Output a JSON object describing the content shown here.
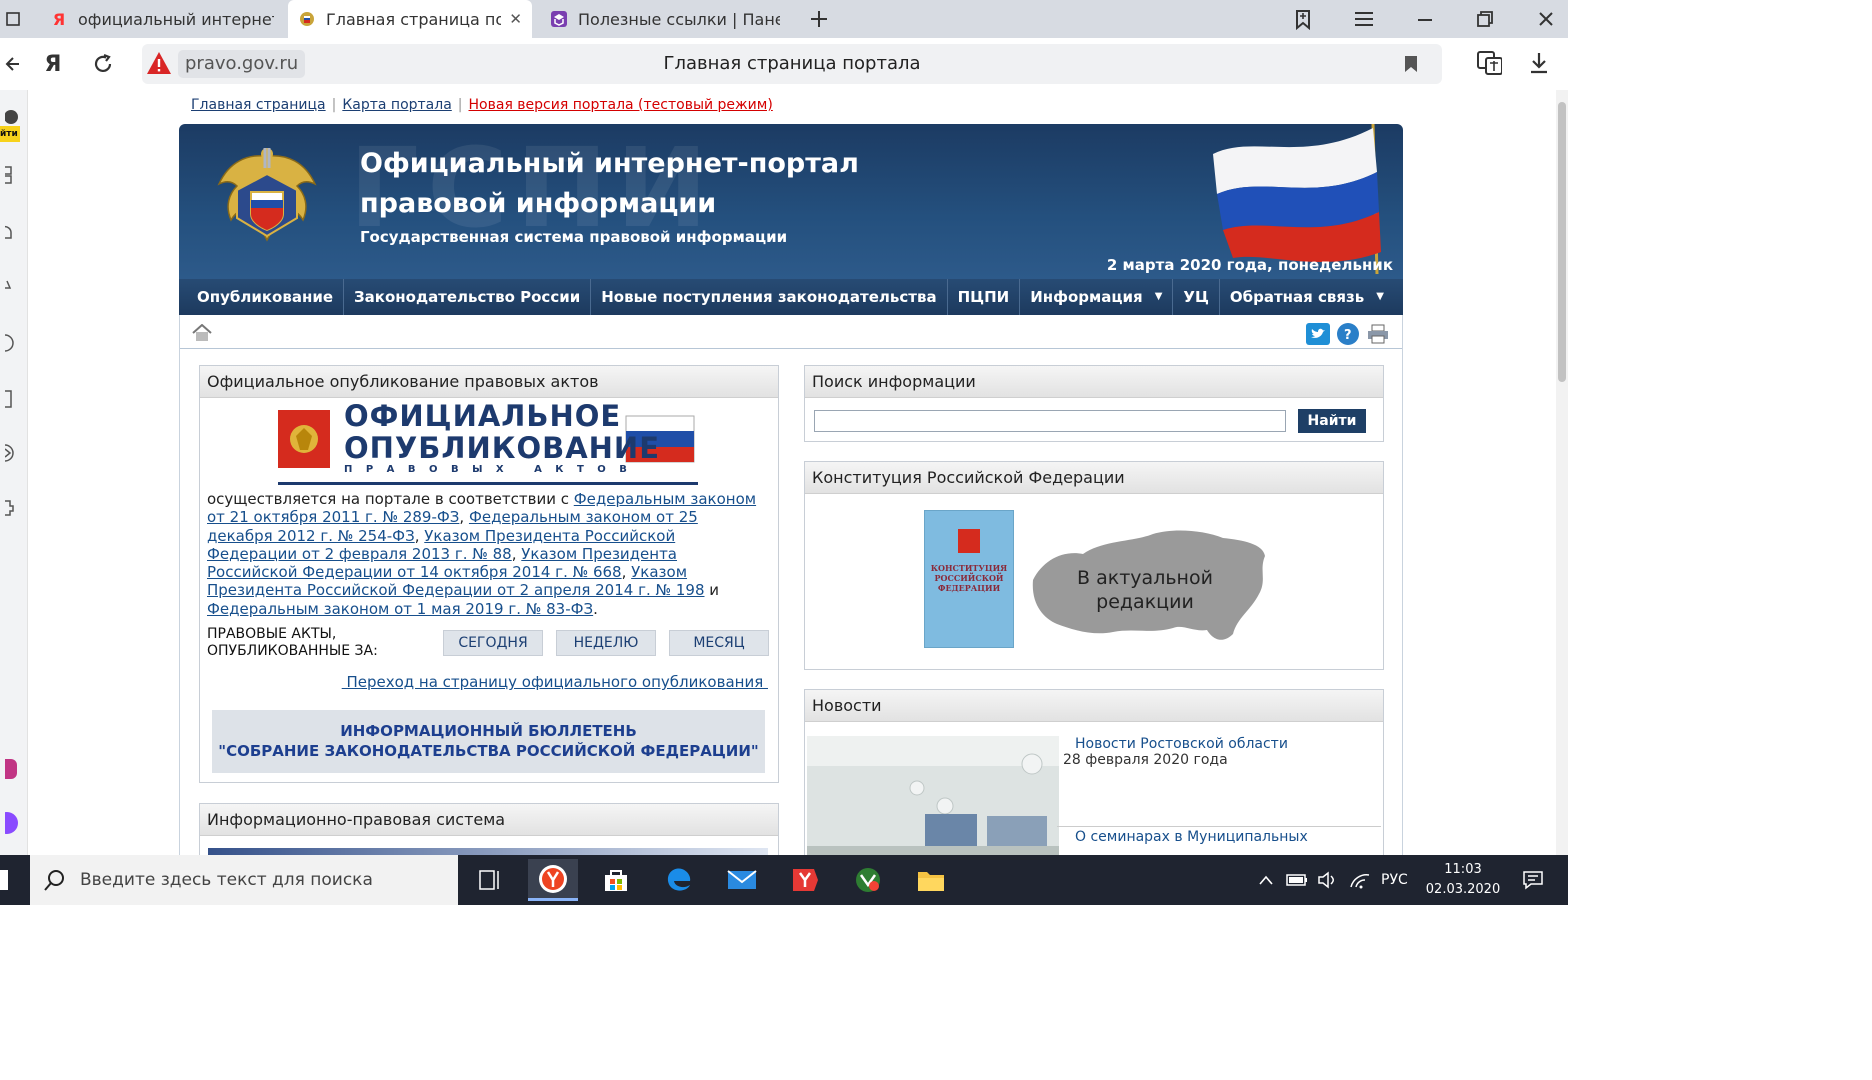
{
  "browser": {
    "tabs": [
      {
        "title": "официальный интернет -п",
        "favicon": "yandex-icon",
        "active": false
      },
      {
        "title": "Главная страница порта",
        "favicon": "emblem-icon",
        "active": true
      },
      {
        "title": "Полезные ссылки | Панель",
        "favicon": "panel-icon",
        "active": false
      }
    ],
    "address": {
      "domain": "pravo.gov.ru",
      "page_title": "Главная страница портала",
      "yandex_label": "Я"
    },
    "sidebar_badge": "йти"
  },
  "site": {
    "top_links": [
      "Главная страница",
      "Карта портала",
      "Новая версия портала (тестовый режим)"
    ],
    "banner": {
      "watermark": "ГСПИ",
      "title": "Официальный интернет-портал правовой информации",
      "subtitle": "Государственная система правовой информации",
      "date": "2 марта 2020 года, понедельник"
    },
    "nav": [
      "Опубликование",
      "Законодательство России",
      "Новые поступления законодательства",
      "ПЦПИ",
      "Информация",
      "УЦ",
      "Обратная связь"
    ],
    "publication": {
      "header": "Официальное опубликование правовых актов",
      "logo_line1": "ОФИЦИАЛЬНОЕ",
      "logo_line2": "ОПУБЛИКОВАНИЕ",
      "logo_line3": "П Р А В О В Ы Х   А К Т О В",
      "text_intro": "осуществляется на портале в соответствии с ",
      "link1": "Федеральным  законом от 21 октября 2011 г. № 289-ФЗ",
      "link2": "Федеральным законом от 25 декабря 2012 г. № 254-ФЗ",
      "link3": "Указом Президента Российской Федерации от 2 февраля 2013 г. № 88",
      "link4": "Указом Президента Российской Федерации от 14 октября 2014 г. № 668",
      "link5": "Указом Президента Российской Федерации от 2 апреля 2014 г. № 198",
      "and_word": " и ",
      "link6": "Федеральным законом от 1 мая 2019 г. № 83-ФЗ",
      "acts_label_1": "ПРАВОВЫЕ АКТЫ,",
      "acts_label_2": "ОПУБЛИКОВАННЫЕ ЗА:",
      "btn_today": "СЕГОДНЯ",
      "btn_week": "НЕДЕЛЮ",
      "btn_month": "МЕСЯЦ",
      "goto_link": " Переход на страницу официального опубликования ",
      "bulletin_1": "ИНФОРМАЦИОННЫЙ БЮЛЛЕТЕНЬ",
      "bulletin_2": "\"СОБРАНИЕ ЗАКОНОДАТЕЛЬСТВА РОССИЙСКОЙ ФЕДЕРАЦИИ\""
    },
    "ips": {
      "header": "Информационно-правовая система"
    },
    "search": {
      "header": "Поиск информации",
      "button": "Найти",
      "value": ""
    },
    "constitution": {
      "header": "Конституция Российской Федерации",
      "book_title_1": "КОНСТИТУЦИЯ",
      "book_title_2": "РОССИЙСКОЙ",
      "book_title_3": "ФЕДЕРАЦИИ",
      "map_text_1": "В актуальной",
      "map_text_2": "редакции"
    },
    "news": {
      "header": "Новости",
      "items": [
        {
          "title": "Новости Ростовской области",
          "date": "28 февраля 2020 года"
        },
        {
          "title": "О семинарах в Муниципальных",
          "date": ""
        }
      ]
    }
  },
  "taskbar": {
    "search_placeholder": "Введите здесь текст для поиска",
    "lang": "РУС",
    "time": "11:03",
    "date": "02.03.2020"
  },
  "colors": {
    "banner": "#1c3b63",
    "nav": "#1d3a5e",
    "link": "#174f8c",
    "red_link": "#d40000",
    "taskbar": "#1f2430"
  }
}
